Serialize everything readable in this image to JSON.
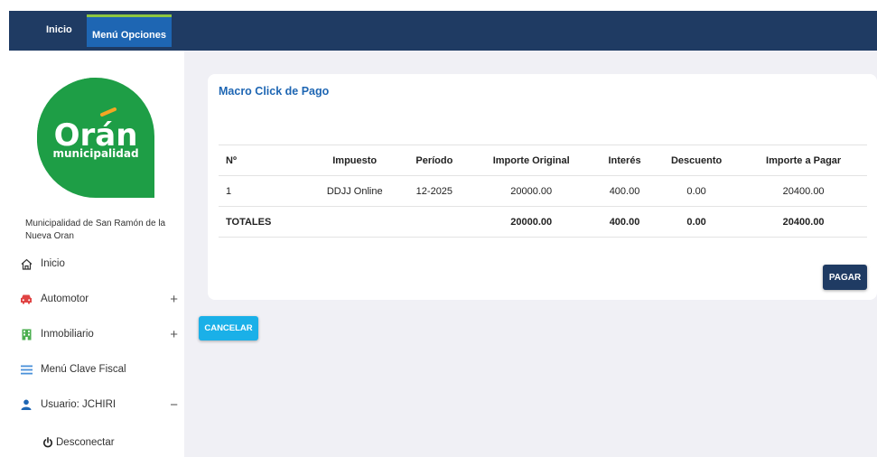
{
  "nav": {
    "inicio": "Inicio",
    "menu_opciones": "Menú Opciones"
  },
  "logo": {
    "word": "Orán",
    "sub": "municipalidad",
    "color": "#1e9e46",
    "accent": "#f5a623"
  },
  "sidebar": {
    "muni_name": "Municipalidad de San Ramón de la Nueva Oran",
    "items": [
      {
        "label": "Inicio",
        "icon": "home-icon",
        "sign": ""
      },
      {
        "label": "Automotor",
        "icon": "car-icon",
        "sign": "+"
      },
      {
        "label": "Inmobiliario",
        "icon": "building-icon",
        "sign": "+"
      },
      {
        "label": "Menú Clave Fiscal",
        "icon": "menu-icon",
        "sign": ""
      },
      {
        "label": "Usuario: JCHIRI",
        "icon": "user-icon",
        "sign": "−"
      }
    ],
    "logout": "Desconectar"
  },
  "card": {
    "title": "Macro Click de Pago",
    "headers": [
      "Nº",
      "Impuesto",
      "Período",
      "Importe Original",
      "Interés",
      "Descuento",
      "Importe a Pagar"
    ],
    "rows": [
      [
        "1",
        "DDJJ Online",
        "12-2025",
        "20000.00",
        "400.00",
        "0.00",
        "20400.00"
      ]
    ],
    "totals": [
      "TOTALES",
      "",
      "",
      "20000.00",
      "400.00",
      "0.00",
      "20400.00"
    ],
    "pay_label": "PAGAR"
  },
  "cancel_label": "CANCELAR",
  "colors": {
    "topbar": "#1f3b63",
    "menu_active": "#1e66b3",
    "menu_active_border": "#8dc63f",
    "pay_button": "#1f3b63",
    "cancel_button": "#1ab0e8",
    "content_bg": "#f0f0f5"
  }
}
